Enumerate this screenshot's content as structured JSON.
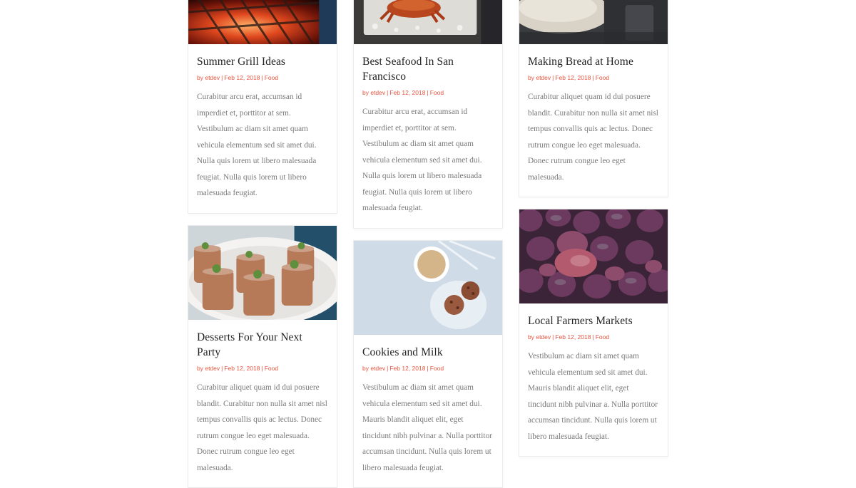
{
  "posts": [
    {
      "title": "Summer Grill Ideas",
      "author": "by etdev",
      "date": "Feb 12, 2018",
      "category": "Food",
      "excerpt": "Curabitur arcu erat, accumsan id imperdiet et, porttitor at sem. Vestibulum ac diam sit amet quam vehicula elementum sed sit amet dui. Nulla quis lorem ut libero malesuada feugiat. Nulla quis lorem ut libero malesuada feugiat.",
      "image": "grill-photo"
    },
    {
      "title": "Best Seafood In San Francisco",
      "author": "by etdev",
      "date": "Feb 12, 2018",
      "category": "Food",
      "excerpt": "Curabitur arcu erat, accumsan id imperdiet et, porttitor at sem. Vestibulum ac diam sit amet quam vehicula elementum sed sit amet dui. Nulla quis lorem ut libero malesuada feugiat. Nulla quis lorem ut libero malesuada feugiat.",
      "image": "crab-photo"
    },
    {
      "title": "Making Bread at Home",
      "author": "by etdev",
      "date": "Feb 12, 2018",
      "category": "Food",
      "excerpt": "Curabitur aliquet quam id dui posuere blandit. Curabitur non nulla sit amet nisl tempus convallis quis ac lectus. Donec rutrum congue leo eget malesuada. Donec rutrum congue leo eget malesuada.",
      "image": "bread-photo"
    },
    {
      "title": "Desserts For Your Next Party",
      "author": "by etdev",
      "date": "Feb 12, 2018",
      "category": "Food",
      "excerpt": "Curabitur aliquet quam id dui posuere blandit. Curabitur non nulla sit amet nisl tempus convallis quis ac lectus. Donec rutrum congue leo eget malesuada. Donec rutrum congue leo eget malesuada.",
      "image": "desserts-photo"
    },
    {
      "title": "Cookies and Milk",
      "author": "by etdev",
      "date": "Feb 12, 2018",
      "category": "Food",
      "excerpt": "Vestibulum ac diam sit amet quam vehicula elementum sed sit amet dui. Mauris blandit aliquet elit, eget tincidunt nibh pulvinar a. Nulla porttitor accumsan tincidunt. Nulla quis lorem ut libero malesuada feugiat.",
      "image": "cookies-photo"
    },
    {
      "title": "Local Farmers Markets",
      "author": "by etdev",
      "date": "Feb 12, 2018",
      "category": "Food",
      "excerpt": "Vestibulum ac diam sit amet quam vehicula elementum sed sit amet dui. Mauris blandit aliquet elit, eget tincidunt nibh pulvinar a. Nulla porttitor accumsan tincidunt. Nulla quis lorem ut libero malesuada feugiat.",
      "image": "figs-photo"
    }
  ],
  "meta_separator": "|",
  "colors": {
    "accent": "#e4543f",
    "title": "#222222",
    "text": "#7a7a7a",
    "border": "#ececec"
  }
}
